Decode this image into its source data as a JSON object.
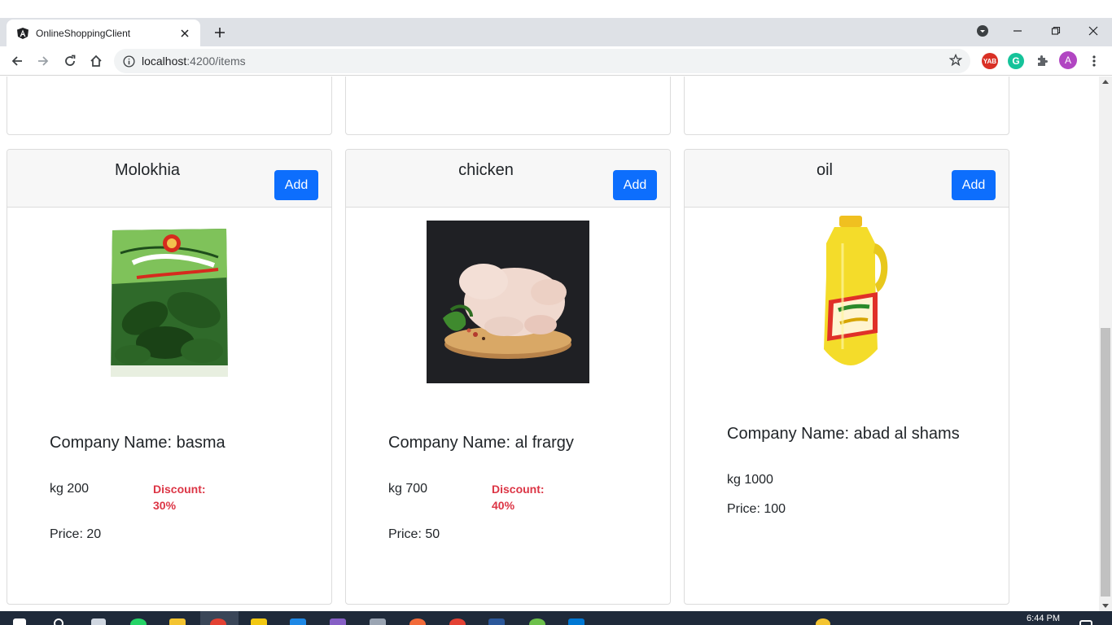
{
  "browser": {
    "tab_title": "OnlineShoppingClient",
    "url_host": "localhost",
    "url_path": ":4200/items",
    "profile_initial": "A",
    "ext_yab_label": "YAB",
    "ext_g_label": "G"
  },
  "products": [
    {
      "name": "Molokhia",
      "add_label": "Add",
      "company": "Company Name: basma",
      "quantity": "kg 200",
      "discount": "Discount: 30%",
      "price": "Price: 20",
      "image_name": "molokhia-package-image"
    },
    {
      "name": "chicken",
      "add_label": "Add",
      "company": "Company Name: al frargy",
      "quantity": "kg 700",
      "discount": "Discount: 40%",
      "price": "Price: 50",
      "image_name": "chicken-image"
    },
    {
      "name": "oil",
      "add_label": "Add",
      "company": "Company Name: abad al shams",
      "quantity": "kg 1000",
      "price": "Price: 100",
      "image_name": "oil-bottle-image"
    }
  ],
  "taskbar": {
    "clock": "6:44 PM"
  },
  "colors": {
    "accent": "#0d6efd",
    "discount": "#dc3545"
  }
}
